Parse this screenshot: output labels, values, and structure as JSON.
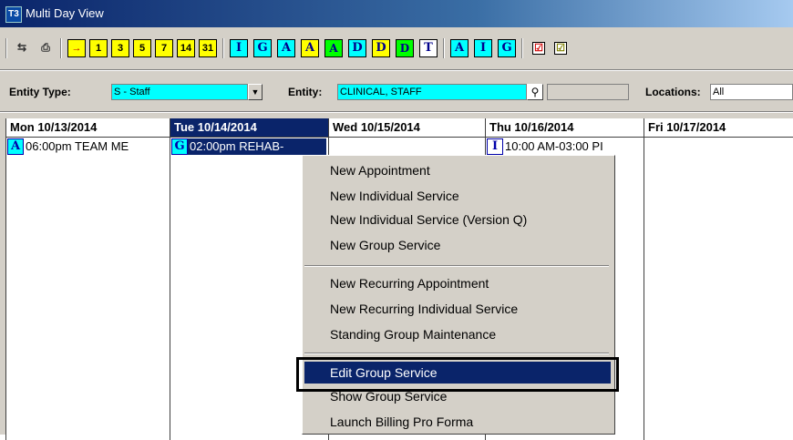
{
  "window": {
    "title": "Multi Day View",
    "app_icon": "T3"
  },
  "toolbar": {
    "buttons": [
      {
        "label": "⇆",
        "icon": "refresh-icon"
      },
      {
        "label": "⎙",
        "icon": "print-icon"
      },
      {
        "label": "→",
        "icon": "day-arrow-icon"
      },
      {
        "label": "1"
      },
      {
        "label": "3"
      },
      {
        "label": "5"
      },
      {
        "label": "7"
      },
      {
        "label": "14"
      },
      {
        "label": "31"
      },
      {
        "label": "I"
      },
      {
        "label": "G"
      },
      {
        "label": "A"
      },
      {
        "label": "A"
      },
      {
        "label": "A"
      },
      {
        "label": "D"
      },
      {
        "label": "D"
      },
      {
        "label": "D"
      },
      {
        "label": "T"
      },
      {
        "label": "A"
      },
      {
        "label": "I"
      },
      {
        "label": "G"
      },
      {
        "label": "☑"
      },
      {
        "label": "☑"
      }
    ]
  },
  "filters": {
    "entity_type_label": "Entity Type:",
    "entity_type_value": "S - Staff",
    "entity_label": "Entity:",
    "entity_value": "CLINICAL, STAFF",
    "locations_label": "Locations:",
    "locations_value": "All"
  },
  "calendar": {
    "days": [
      {
        "header": "Mon 10/13/2014",
        "events": [
          {
            "badge": "A",
            "text": "06:00pm TEAM ME"
          }
        ]
      },
      {
        "header": "Tue 10/14/2014",
        "events": [
          {
            "badge": "G",
            "text": "02:00pm REHAB-"
          }
        ]
      },
      {
        "header": "Wed 10/15/2014",
        "events": []
      },
      {
        "header": "Thu 10/16/2014",
        "events": [
          {
            "badge": "I",
            "text": "10:00 AM-03:00 PI"
          }
        ]
      },
      {
        "header": "Fri 10/17/2014",
        "events": []
      }
    ]
  },
  "context_menu": {
    "items": [
      "New Appointment",
      "New Individual Service",
      "New Individual Service (Version Q)",
      "New Group Service",
      "New Recurring Appointment",
      "New Recurring Individual Service",
      "Standing Group Maintenance",
      "Edit Group Service",
      "Show Group Service",
      "Launch Billing Pro Forma"
    ],
    "highlighted": "Edit Group Service"
  },
  "colors": {
    "title_bar": "#0a246a",
    "selection": "#0a246a",
    "accent_cyan": "#00ffff",
    "accent_yellow": "#ffff00",
    "accent_green": "#00ff00"
  }
}
